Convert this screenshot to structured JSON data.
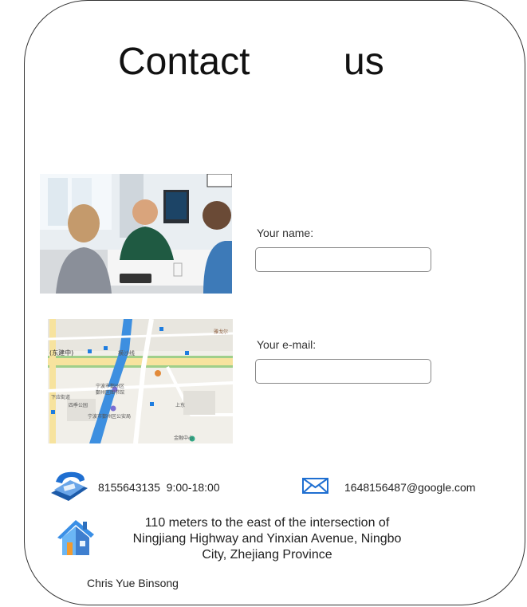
{
  "header": {
    "title_word1": "Contact",
    "title_word2": "us"
  },
  "form": {
    "name_label": "Your name:",
    "name_value": "",
    "email_label": "Your e-mail:",
    "email_value": ""
  },
  "contact": {
    "phone": "8155643135",
    "hours": "9:00-18:00",
    "email": "1648156487@google.com",
    "address": "110 meters to the east of the intersection of Ningjiang Highway and Yinxian Avenue, Ningbo City, Zhejiang Province"
  },
  "map": {
    "labels": [
      "(东建中)",
      "横沙线",
      "宁波市鄞州区",
      "鄞州区图书馆",
      "宁波市鄞州区公安局",
      "四季公园",
      "下应街道",
      "鄞州区政府",
      "金融中心",
      "上东",
      "雅戈尔"
    ]
  },
  "footer": {
    "author": "Chris Yue Binsong"
  },
  "icons": {
    "phone": "telephone-icon",
    "email": "envelope-icon",
    "address": "house-icon"
  },
  "colors": {
    "accent_blue": "#1f6fd1",
    "border": "#333333"
  }
}
